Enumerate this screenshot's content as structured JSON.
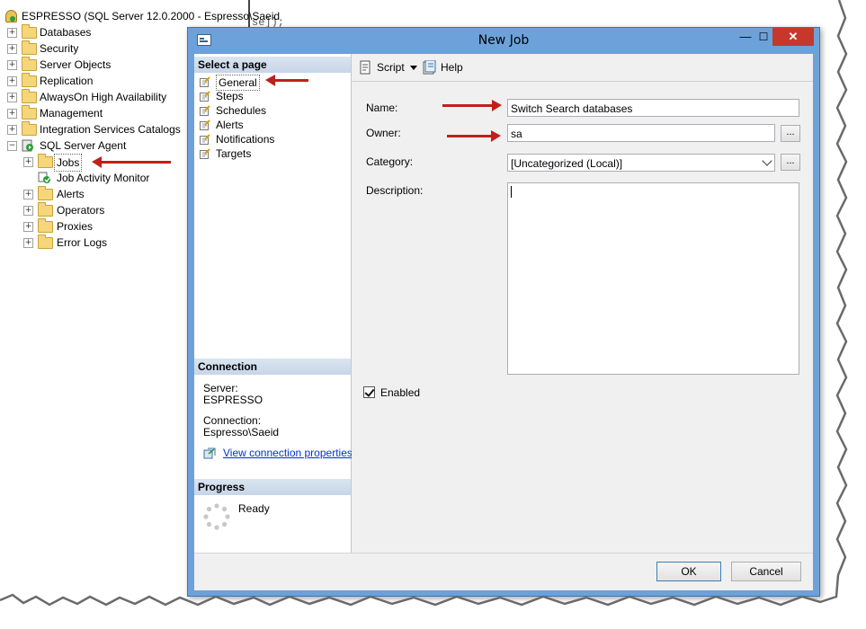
{
  "explorer": {
    "server_node": "ESPRESSO (SQL Server 12.0.2000 - Espresso\\Saeid",
    "behind_code": "se]);",
    "nodes": [
      {
        "label": "Databases"
      },
      {
        "label": "Security"
      },
      {
        "label": "Server Objects"
      },
      {
        "label": "Replication"
      },
      {
        "label": "AlwaysOn High Availability"
      },
      {
        "label": "Management"
      },
      {
        "label": "Integration Services Catalogs"
      },
      {
        "label": "SQL Server Agent"
      }
    ],
    "agent_children": [
      {
        "label": "Jobs"
      },
      {
        "label": "Job Activity Monitor"
      },
      {
        "label": "Alerts"
      },
      {
        "label": "Operators"
      },
      {
        "label": "Proxies"
      },
      {
        "label": "Error Logs"
      }
    ]
  },
  "dialog": {
    "title": "New Job",
    "minimize": "—",
    "maximize": "☐",
    "close": "✕",
    "select_page_header": "Select a page",
    "pages": [
      "General",
      "Steps",
      "Schedules",
      "Alerts",
      "Notifications",
      "Targets"
    ],
    "connection_header": "Connection",
    "server_label": "Server:",
    "server_value": "ESPRESSO",
    "connection_label": "Connection:",
    "connection_value": "Espresso\\Saeid",
    "view_connection_link": "View connection properties",
    "progress_header": "Progress",
    "progress_status": "Ready",
    "toolbar": {
      "script": "Script",
      "help": "Help"
    },
    "form": {
      "name_label": "Name:",
      "name_value": "Switch Search databases",
      "owner_label": "Owner:",
      "owner_value": "sa",
      "category_label": "Category:",
      "category_value": "[Uncategorized (Local)]",
      "description_label": "Description:",
      "description_value": "",
      "browse_label": "...",
      "enabled_label": "Enabled",
      "enabled": true
    },
    "ok_label": "OK",
    "cancel_label": "Cancel"
  },
  "colors": {
    "titlebar": "#6ca1d9",
    "close": "#c7382c",
    "arrow": "#c0201c",
    "link": "#0033cc"
  }
}
